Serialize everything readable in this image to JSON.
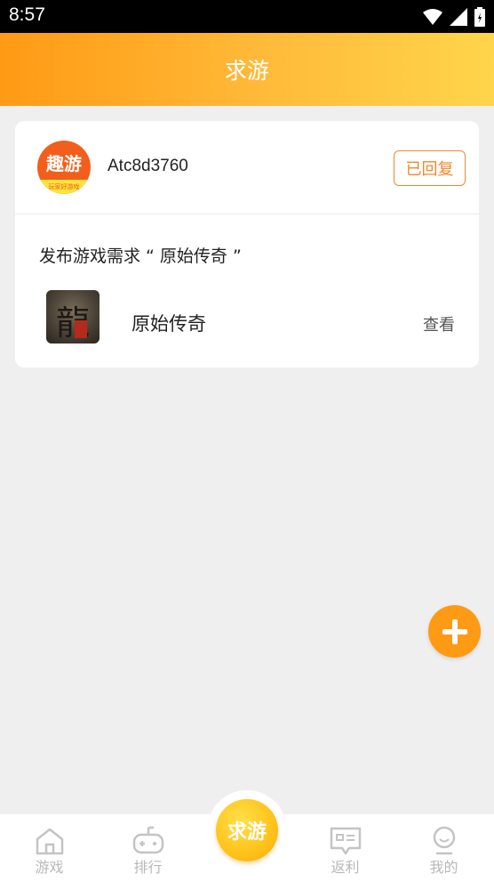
{
  "status_bar": {
    "time": "8:57",
    "icons": [
      "wifi-icon",
      "signal-icon",
      "battery-icon"
    ]
  },
  "header": {
    "title": "求游"
  },
  "card": {
    "avatar": {
      "logo_text": "趣游",
      "tagline": "玩家好游戏"
    },
    "username": "Atc8d3760",
    "reply_status": "已回复",
    "request_text": "发布游戏需求 “ 原始传奇 ”",
    "game": {
      "icon_glyph": "龍",
      "name": "原始传奇",
      "view_label": "查看"
    }
  },
  "fab": {
    "icon": "plus-icon"
  },
  "tabbar": {
    "tabs": [
      {
        "label": "游戏",
        "icon": "home-icon"
      },
      {
        "label": "排行",
        "icon": "gamepad-icon"
      },
      {
        "label": "求游",
        "icon": "center-request-icon"
      },
      {
        "label": "返利",
        "icon": "message-icon"
      },
      {
        "label": "我的",
        "icon": "profile-icon"
      }
    ]
  },
  "colors": {
    "accent": "#ff9a14",
    "header_end": "#ffd54a",
    "reply_border": "#f0882a",
    "tab_inactive": "#b8b8b8"
  }
}
